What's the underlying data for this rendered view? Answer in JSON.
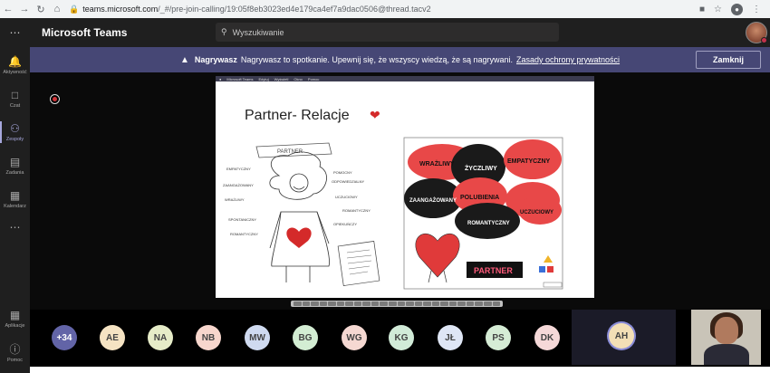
{
  "browser": {
    "url_host": "teams.microsoft.com",
    "url_path": "/_#/pre-join-calling/19:05f8eb3023ed4e179ca4ef7a9dac0506@thread.tacv2"
  },
  "header": {
    "app_title": "Microsoft Teams",
    "search_placeholder": "Wyszukiwanie"
  },
  "rail": [
    {
      "label": "Aktywność",
      "icon": "bell-icon"
    },
    {
      "label": "Czat",
      "icon": "chat-icon"
    },
    {
      "label": "Zespoły",
      "icon": "teams-icon",
      "active": true
    },
    {
      "label": "Zadania",
      "icon": "tasks-icon"
    },
    {
      "label": "Kalendarz",
      "icon": "calendar-icon"
    },
    {
      "label": "Aplikacje",
      "icon": "apps-icon"
    },
    {
      "label": "Pomoc",
      "icon": "help-icon"
    }
  ],
  "banner": {
    "bold": "Nagrywasz",
    "text": "Nagrywasz to spotkanie. Upewnij się, że wszyscy wiedzą, że są nagrywani.",
    "link": "Zasady ochrony prywatności",
    "close_label": "Zamknij"
  },
  "slide": {
    "title": "Partner- Relacje",
    "menu_items": [
      "Microsoft Teams",
      "Edytuj",
      "Wyświetl",
      "Okno",
      "Pomoc"
    ],
    "left_words": [
      "PARTNER",
      "EMPATYCZNY",
      "ZAANGAŻOWANY",
      "WRAŻLIWY",
      "SPONTANICZNY",
      "ROMANTYCZNY",
      "POMOCNY",
      "ODPOWIEDZIALNY",
      "UCZUCIOWY",
      "ROMANTYCZNY",
      "OPIEKUŃCZY"
    ],
    "clouds": [
      "WRAŻLIWY",
      "ŻYCZLIWY",
      "EMPATYCZNY",
      "ZAANGAŻOWANY",
      "POLUBIENIA",
      "ROMANTYCZNY",
      "UCZUCIOWY"
    ],
    "badge": "PARTNER"
  },
  "participants": {
    "more": "+34",
    "chips": [
      {
        "initials": "AE",
        "color": "#f5e3c3"
      },
      {
        "initials": "NA",
        "color": "#e6ecc8"
      },
      {
        "initials": "NB",
        "color": "#f7d6cd"
      },
      {
        "initials": "MW",
        "color": "#cfdaf0"
      },
      {
        "initials": "BG",
        "color": "#d3edd3"
      },
      {
        "initials": "WG",
        "color": "#f5d8d2"
      },
      {
        "initials": "KG",
        "color": "#d1ebd8"
      },
      {
        "initials": "JŁ",
        "color": "#dfe6f5"
      },
      {
        "initials": "PS",
        "color": "#d5ecd5"
      },
      {
        "initials": "DK",
        "color": "#f5d8d8"
      }
    ],
    "active": "AH"
  }
}
